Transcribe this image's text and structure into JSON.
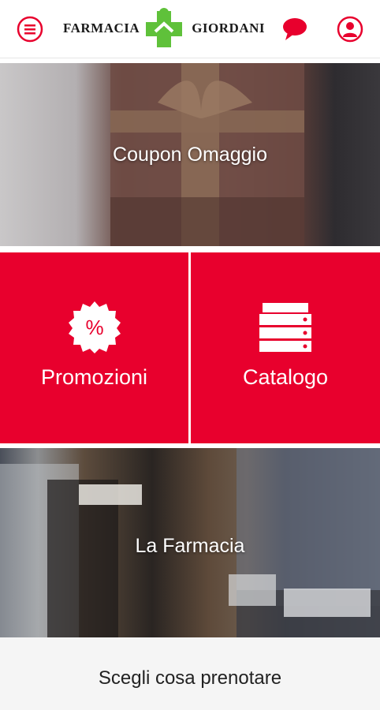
{
  "header": {
    "logo_left": "FARMACIA",
    "logo_right": "GIORDANI"
  },
  "tiles": {
    "coupon": "Coupon Omaggio",
    "promozioni": "Promozioni",
    "catalogo": "Catalogo",
    "farmacia": "La Farmacia",
    "prenota": "Scegli cosa prenotare"
  },
  "icons": {
    "menu": "menu-icon",
    "chat": "chat-icon",
    "user": "user-icon",
    "percent": "percent-badge-icon",
    "catalog": "catalog-drawers-icon"
  },
  "colors": {
    "accent": "#e8002d",
    "logo_green": "#5fc13a"
  }
}
